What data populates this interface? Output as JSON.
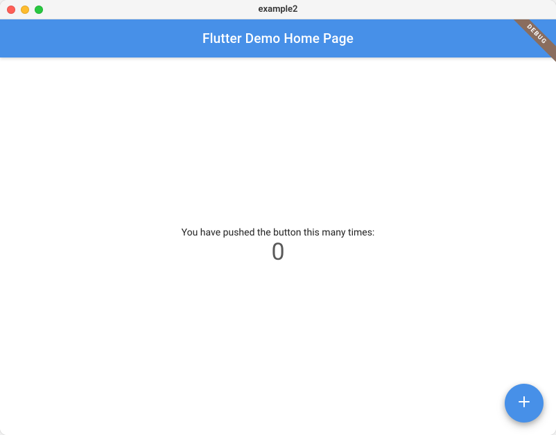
{
  "window": {
    "title": "example2"
  },
  "appbar": {
    "title": "Flutter Demo Home Page"
  },
  "debug_banner": {
    "label": "DEBUG"
  },
  "body": {
    "push_text": "You have pushed the button this many times:",
    "counter": "0"
  },
  "colors": {
    "primary": "#4790e8",
    "banner": "#8a6d5e"
  }
}
